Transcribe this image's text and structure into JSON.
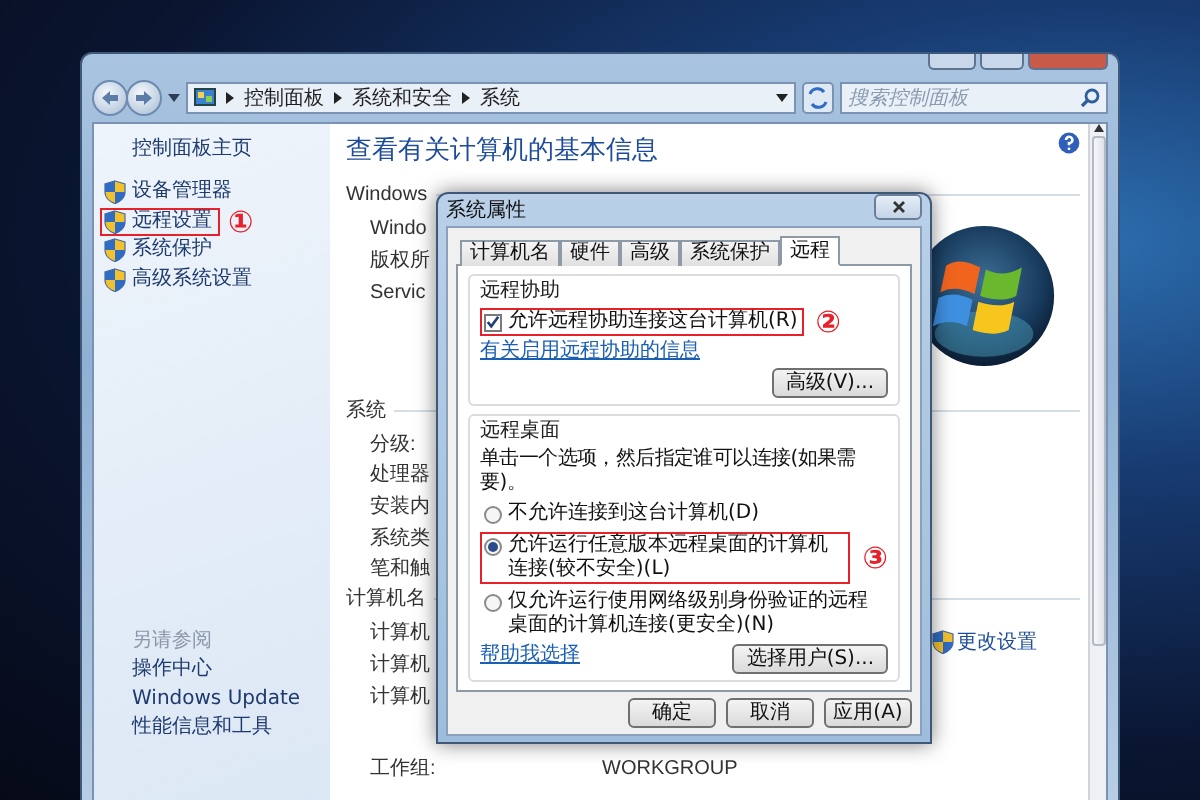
{
  "window": {
    "breadcrumb": [
      "控制面板",
      "系统和安全",
      "系统"
    ],
    "search": {
      "placeholder": "搜索控制面板"
    }
  },
  "sidebar": {
    "home": "控制面板主页",
    "items": [
      {
        "label": "设备管理器",
        "highlighted": false
      },
      {
        "label": "远程设置",
        "highlighted": true,
        "annotation": "①"
      },
      {
        "label": "系统保护",
        "highlighted": false
      },
      {
        "label": "高级系统设置",
        "highlighted": false
      }
    ],
    "see_also": {
      "title": "另请参阅",
      "links": [
        "操作中心",
        "Windows Update",
        "性能信息和工具"
      ]
    }
  },
  "main": {
    "title": "查看有关计算机的基本信息",
    "sections": [
      {
        "kind": "edition",
        "heading": "Windows",
        "rows": [
          {
            "label": "Windo"
          },
          {
            "label": "版权所"
          },
          {
            "label": "Servic"
          }
        ]
      },
      {
        "kind": "plain",
        "heading": "系统",
        "rows": [
          {
            "label": "分级:"
          },
          {
            "label": "处理器"
          },
          {
            "label": "安装内"
          },
          {
            "label": "系统类"
          },
          {
            "label": "笔和触"
          }
        ]
      },
      {
        "kind": "name",
        "heading": "计算机名",
        "rows": [
          {
            "label": "计算机"
          },
          {
            "label": "计算机"
          },
          {
            "label": "计算机"
          },
          {
            "label": "工作组:",
            "value": "WORKGROUP"
          }
        ],
        "action": "更改设置"
      }
    ]
  },
  "dialog": {
    "title": "系统属性",
    "tabs": [
      {
        "label": "计算机名",
        "selected": false
      },
      {
        "label": "硬件",
        "selected": false
      },
      {
        "label": "高级",
        "selected": false
      },
      {
        "label": "系统保护",
        "selected": false
      },
      {
        "label": "远程",
        "selected": true
      }
    ],
    "remote_assistance": {
      "title": "远程协助",
      "checkbox": {
        "label": "允许远程协助连接这台计算机(R)",
        "checked": true,
        "highlighted": true,
        "annotation": "②"
      },
      "link": "有关启用远程协助的信息",
      "button": "高级(V)..."
    },
    "remote_desktop": {
      "title": "远程桌面",
      "instruction": "单击一个选项，然后指定谁可以连接(如果需要)。",
      "options": [
        {
          "label": "不允许连接到这台计算机(D)",
          "selected": false,
          "highlighted": false
        },
        {
          "label": "允许运行任意版本远程桌面的计算机连接(较不安全)(L)",
          "selected": true,
          "highlighted": true,
          "annotation": "③"
        },
        {
          "label": "仅允许运行使用网络级别身份验证的远程桌面的计算机连接(更安全)(N)",
          "selected": false,
          "highlighted": false
        }
      ],
      "link": "帮助我选择",
      "button": "选择用户(S)..."
    },
    "buttons": [
      "确定",
      "取消",
      "应用(A)"
    ]
  }
}
